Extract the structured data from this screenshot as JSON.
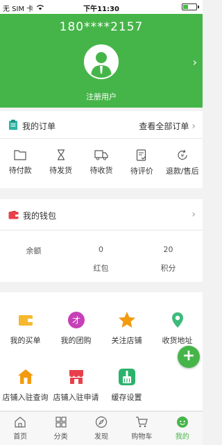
{
  "statusbar": {
    "carrier": "无 SIM 卡",
    "time": "下午11:30",
    "battery_level": 0.4
  },
  "header": {
    "phone": "180****2157",
    "user_label": "注册用户"
  },
  "orders": {
    "title": "我的订单",
    "view_all": "查看全部订单",
    "items": [
      "待付款",
      "待发货",
      "待收货",
      "待评价",
      "退款/售后"
    ]
  },
  "wallet": {
    "title": "我的钱包",
    "balance_label": "余额",
    "redpacket_value": "0",
    "redpacket_label": "红包",
    "points_value": "20",
    "points_label": "积分"
  },
  "services": {
    "row1": [
      "我的买单",
      "我的团购",
      "关注店铺",
      "收货地址"
    ],
    "row2": [
      "店铺入驻查询",
      "店铺入驻申请",
      "缓存设置"
    ]
  },
  "tabbar": {
    "items": [
      "首页",
      "分类",
      "发现",
      "购物车",
      "我的"
    ],
    "active": "我的"
  },
  "colors": {
    "brand": "#46b549",
    "wallet_icon": "#e8404a",
    "order_icon": "#2bb3a3"
  }
}
